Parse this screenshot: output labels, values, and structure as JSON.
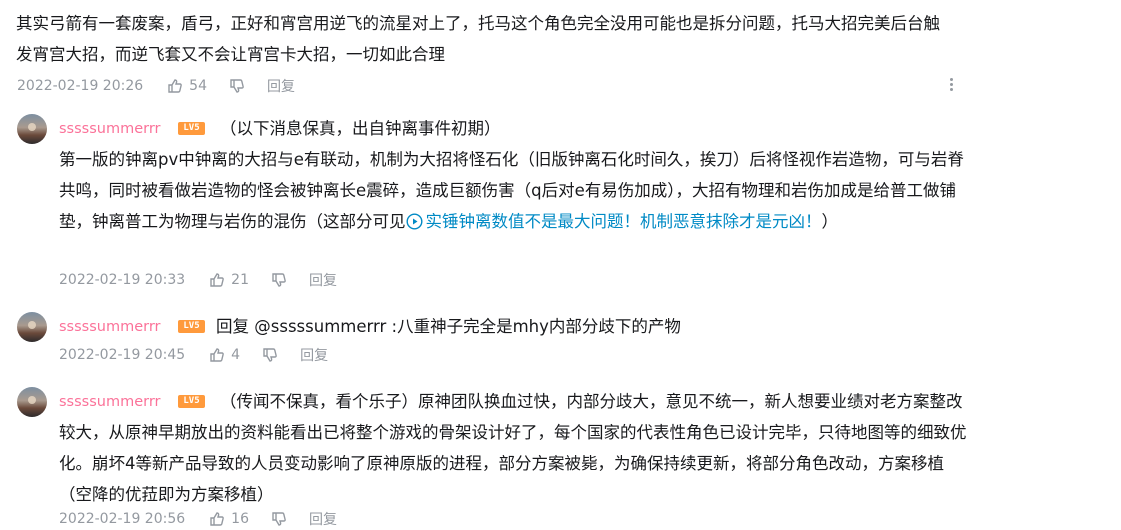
{
  "top_comment": {
    "text": "其实弓箭有一套废案，盾弓，正好和宵宫用逆飞的流星对上了，托马这个角色完全没用可能也是拆分问题，托马大招完美后台触发宵宫大招，而逆飞套又不会让宵宫卡大招，一切如此合理",
    "time": "2022-02-19 20:26",
    "likes": "54",
    "reply_label": "回复"
  },
  "replies": [
    {
      "username": "sssssummerrr",
      "level": "LV5",
      "text_before": "（以下消息保真，出自钟离事件初期）\n第一版的钟离pv中钟离的大招与e有联动，机制为大招将怪石化（旧版钟离石化时间久，挨刀）后将怪视作岩造物，可与岩脊共鸣，同时被看做岩造物的怪会被钟离长e震碎，造成巨额伤害（q后对e有易伤加成），大招有物理和岩伤加成是给普工做铺垫，钟离普工为物理与岩伤的混伤（这部分可见",
      "link_text": "实锤钟离数值不是最大问题！机制恶意抹除才是元凶！",
      "text_after": "）",
      "time": "2022-02-19 20:33",
      "likes": "21",
      "reply_label": "回复"
    },
    {
      "username": "sssssummerrr",
      "level": "LV5",
      "reply_prefix": "回复 ",
      "mention": "@sssssummerrr",
      "text": " :八重神子完全是mhy内部分歧下的产物",
      "time": "2022-02-19 20:45",
      "likes": "4",
      "reply_label": "回复"
    },
    {
      "username": "sssssummerrr",
      "level": "LV5",
      "text": "（传闻不保真，看个乐子）原神团队换血过快，内部分歧大，意见不统一，新人想要业绩对老方案整改较大，从原神早期放出的资料能看出已将整个游戏的骨架设计好了，每个国家的代表性角色已设计完毕，只待地图等的细致优化。崩坏4等新产品导致的人员变动影响了原神原版的进程，部分方案被毙，为确保持续更新，将部分角色改动，方案移植（空降的优菈即为方案移植）",
      "time": "2022-02-19 20:56",
      "likes": "16",
      "reply_label": "回复"
    }
  ],
  "colors": {
    "username": "#fb7299",
    "meta": "#9499a0",
    "link": "#008ac5",
    "level_badge": "#ff9a3c"
  },
  "icons": [
    "like-icon",
    "dislike-icon",
    "more-icon",
    "play-link-icon"
  ]
}
